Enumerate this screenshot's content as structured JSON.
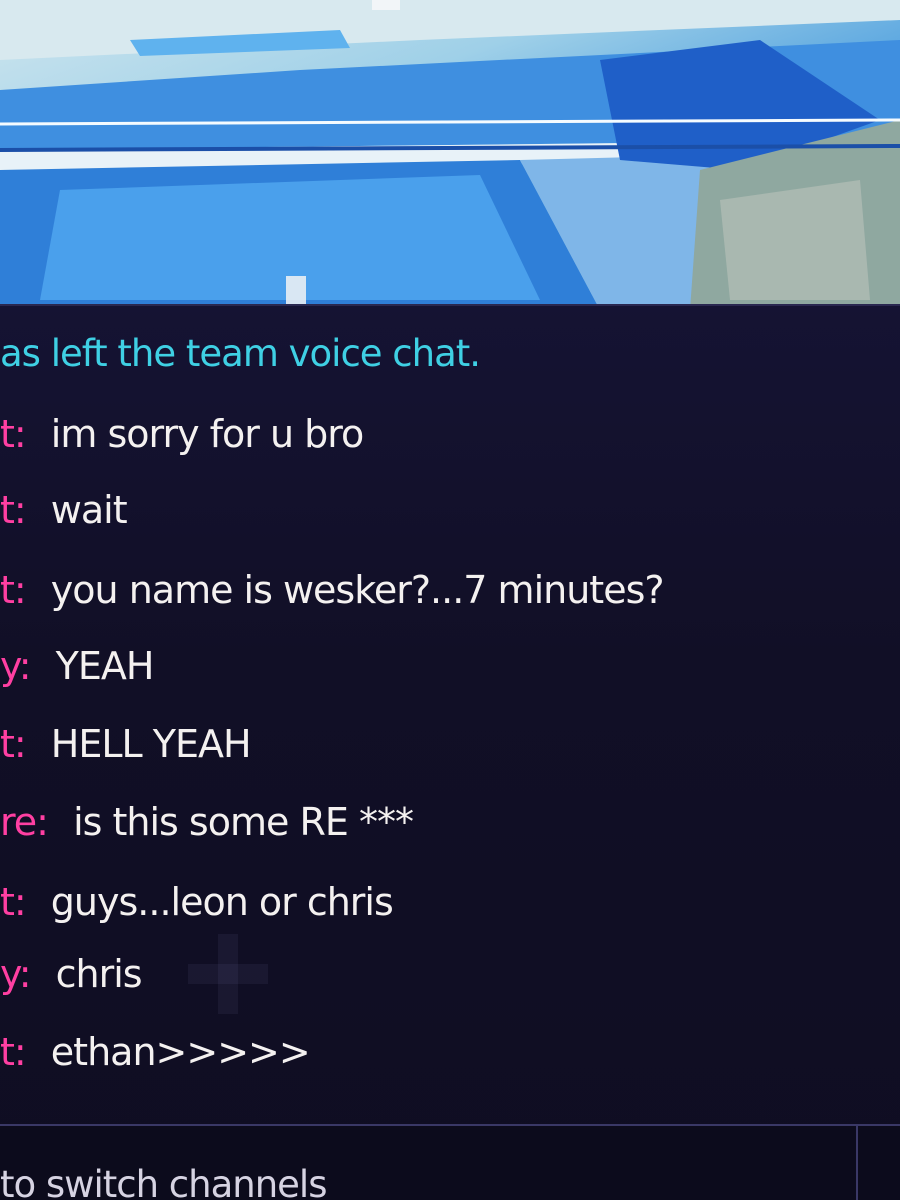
{
  "chat": {
    "system_message": "as left the team voice chat.",
    "messages": [
      {
        "sender": "t:",
        "text": "im sorry for u bro"
      },
      {
        "sender": "t:",
        "text": "wait"
      },
      {
        "sender": "t:",
        "text": "you name is wesker?...7 minutes?"
      },
      {
        "sender": "y:",
        "text": "YEAH"
      },
      {
        "sender": "t:",
        "text": "HELL YEAH"
      },
      {
        "sender": "re:",
        "text": "is this some RE ***"
      },
      {
        "sender": "t:",
        "text": "guys...leon or chris"
      },
      {
        "sender": "y:",
        "text": "chris"
      },
      {
        "sender": "t:",
        "text": "ethan>>>>>"
      }
    ]
  },
  "input_bar": {
    "hint": "to switch channels"
  },
  "colors": {
    "system_text": "#3fd0e4",
    "sender_name": "#ff3fa2",
    "message_text": "#f4f1f0",
    "panel_background": "#110f26"
  }
}
